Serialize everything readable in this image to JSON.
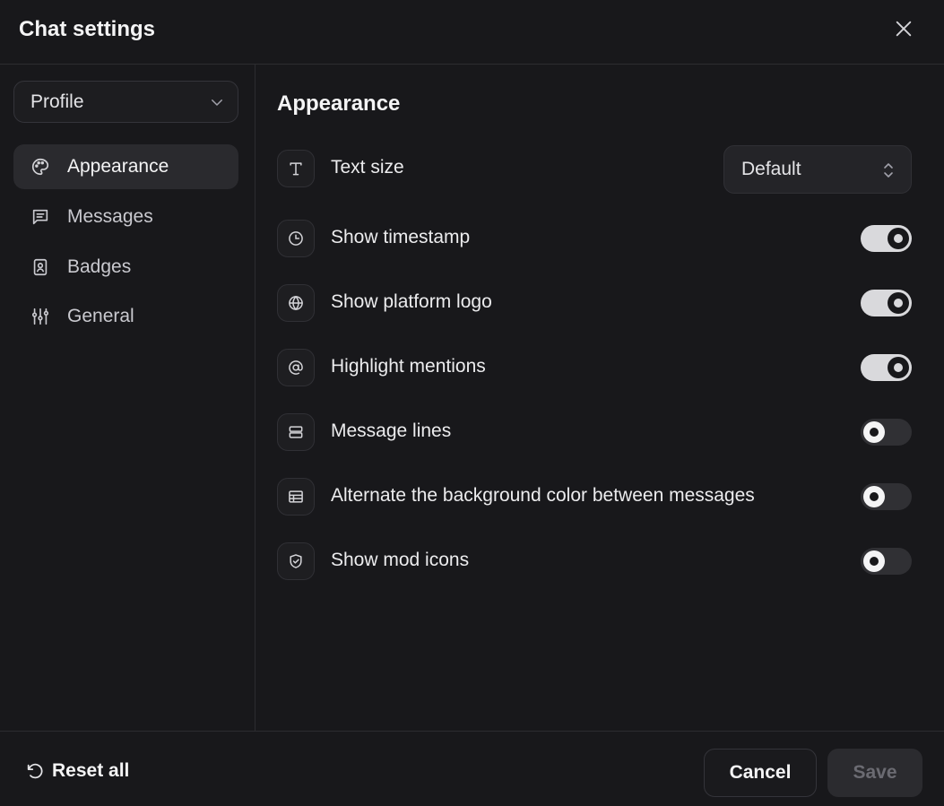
{
  "header": {
    "title": "Chat settings",
    "close_icon": "close-icon"
  },
  "sidebar": {
    "profile_select": {
      "value": "Profile",
      "icon": "chevron-down-icon"
    },
    "items": [
      {
        "label": "Appearance",
        "icon": "palette-icon",
        "active": true
      },
      {
        "label": "Messages",
        "icon": "message-square-icon",
        "active": false
      },
      {
        "label": "Badges",
        "icon": "badge-id-icon",
        "active": false
      },
      {
        "label": "General",
        "icon": "sliders-icon",
        "active": false
      }
    ]
  },
  "main": {
    "section_title": "Appearance",
    "text_size": {
      "label": "Text size",
      "icon": "type-icon",
      "value": "Default"
    },
    "toggles": [
      {
        "label": "Show timestamp",
        "icon": "clock-icon",
        "on": true
      },
      {
        "label": "Show platform logo",
        "icon": "globe-icon",
        "on": true
      },
      {
        "label": "Highlight mentions",
        "icon": "at-sign-icon",
        "on": true
      },
      {
        "label": "Message lines",
        "icon": "rows-icon",
        "on": false
      },
      {
        "label": "Alternate the background color between messages",
        "icon": "table-icon",
        "on": false
      },
      {
        "label": "Show mod icons",
        "icon": "shield-check-icon",
        "on": false
      }
    ]
  },
  "footer": {
    "reset_label": "Reset all",
    "cancel_label": "Cancel",
    "save_label": "Save"
  },
  "colors": {
    "background": "#18181b",
    "border": "#2c2c30",
    "toggle_on": "#d9d9dc",
    "toggle_off": "#303034",
    "text": "#ececee",
    "disabled_text": "#6b6b72"
  }
}
